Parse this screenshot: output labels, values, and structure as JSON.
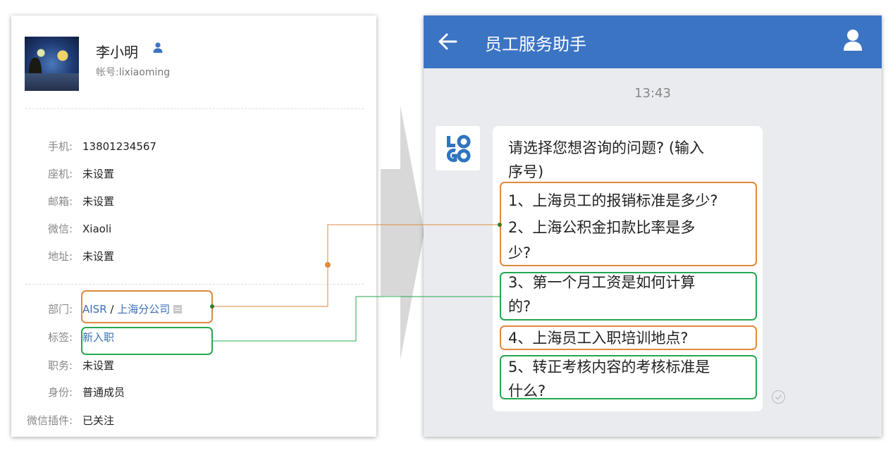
{
  "profile": {
    "name": "李小明",
    "account_label": "帐号:",
    "account_value": "lixiaoming",
    "fields": [
      {
        "label": "手机:",
        "value": "13801234567"
      },
      {
        "label": "座机:",
        "value": "未设置"
      },
      {
        "label": "邮箱:",
        "value": "未设置"
      },
      {
        "label": "微信:",
        "value": "Xiaoli"
      },
      {
        "label": "地址:",
        "value": "未设置"
      }
    ],
    "department": {
      "label": "部门:",
      "org": "AISR",
      "separator": "/",
      "branch": "上海分公司"
    },
    "tag": {
      "label": "标签:",
      "value": "新入职"
    },
    "position": {
      "label": "职务:",
      "value": "未设置"
    },
    "identity": {
      "label": "身份:",
      "value": "普通成员"
    },
    "wechat_plugin": {
      "label": "微信插件:",
      "value": "已关注"
    }
  },
  "chat": {
    "title": "员工服务助手",
    "time": "13:43",
    "logo_text": "LOGO",
    "message_lines": [
      "请选择您想咨询的问题? (输入",
      "序号)",
      "1、上海员工的报销标准是多少?",
      "2、上海公积金扣款比率是多",
      "少?",
      "3、第一个月工资是如何计算",
      "的?",
      "4、上海员工入职培训地点?",
      "5、转正考核内容的考核标准是",
      "什么?"
    ]
  },
  "colors": {
    "header_blue": "#3c74c4",
    "highlight_orange": "#e08a3c",
    "highlight_green": "#23a84f",
    "link_blue": "#3b6fb6"
  },
  "icons": [
    "person-icon",
    "document-icon",
    "back-arrow-icon",
    "user-icon",
    "read-check-icon"
  ]
}
